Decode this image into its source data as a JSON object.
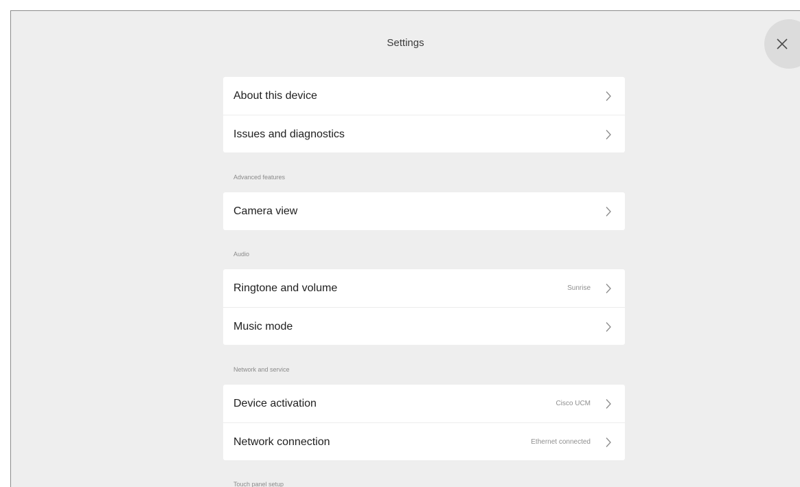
{
  "header": {
    "title": "Settings",
    "close_icon": "close-icon"
  },
  "groups": [
    {
      "section": "",
      "items": [
        {
          "label": "About this device",
          "value": ""
        },
        {
          "label": "Issues and diagnostics",
          "value": ""
        }
      ]
    },
    {
      "section": "Advanced features",
      "items": [
        {
          "label": "Camera view",
          "value": ""
        }
      ]
    },
    {
      "section": "Audio",
      "items": [
        {
          "label": "Ringtone and volume",
          "value": "Sunrise"
        },
        {
          "label": "Music mode",
          "value": ""
        }
      ]
    },
    {
      "section": "Network and service",
      "items": [
        {
          "label": "Device activation",
          "value": "Cisco UCM"
        },
        {
          "label": "Network connection",
          "value": "Ethernet connected"
        }
      ]
    },
    {
      "section": "Touch panel setup",
      "items": []
    }
  ],
  "colors": {
    "background": "#eeeeee",
    "card": "#ffffff",
    "close_button": "#dcdcdc"
  },
  "row_icon": "chevron-right-icon"
}
